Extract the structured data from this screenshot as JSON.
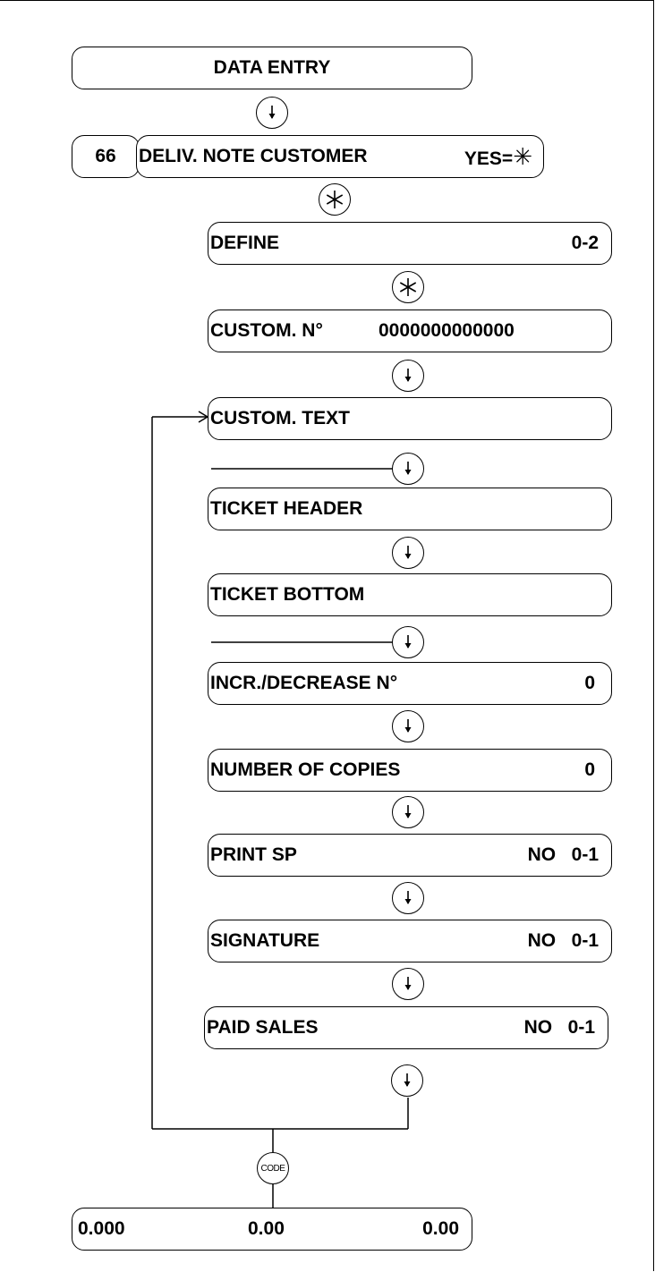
{
  "flow": {
    "data_entry": "DATA ENTRY",
    "menu_number": "66",
    "deliv_note": {
      "label": "DELIV. NOTE CUSTOMER",
      "value": "YES=",
      "star_glyph": "✳"
    },
    "define": {
      "label": "DEFINE",
      "value": "0-2"
    },
    "custom_no": {
      "label": "CUSTOM. N°",
      "value": "0000000000000"
    },
    "custom_text": {
      "label": "CUSTOM. TEXT"
    },
    "ticket_header": {
      "label": "TICKET HEADER"
    },
    "ticket_bottom": {
      "label": "TICKET BOTTOM"
    },
    "incr_decrease": {
      "label": "INCR./DECREASE N°",
      "value": "0"
    },
    "number_copies": {
      "label": "NUMBER OF COPIES",
      "value": "0"
    },
    "print_sp": {
      "label": "PRINT SP",
      "value": "NO   0-1"
    },
    "signature": {
      "label": "SIGNATURE",
      "value": "NO   0-1"
    },
    "paid_sales": {
      "label": "PAID SALES",
      "value": "NO   0-1"
    },
    "code_key": "CODE",
    "display": {
      "weight": "0.000",
      "unit_price": "0.00",
      "total": "0.00"
    }
  },
  "icons": {
    "arrow_key": "down-arrow-icon",
    "star_key": "asterisk-icon",
    "code_key": "code-key-icon"
  }
}
